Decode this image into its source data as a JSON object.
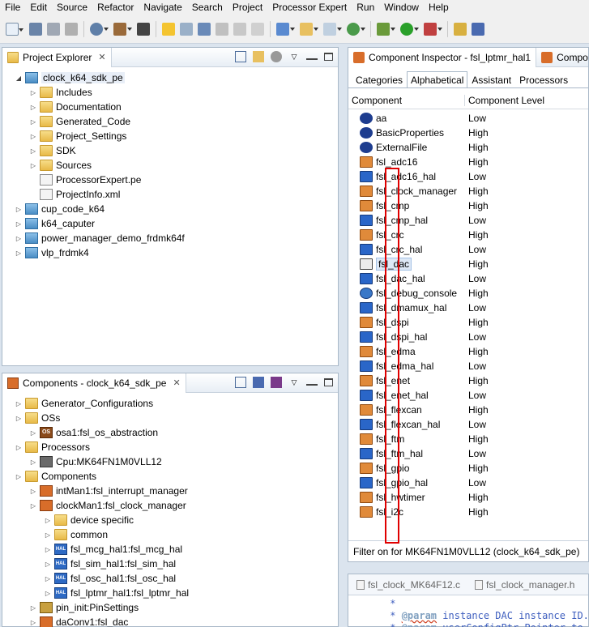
{
  "menu": [
    "File",
    "Edit",
    "Source",
    "Refactor",
    "Navigate",
    "Search",
    "Project",
    "Processor Expert",
    "Run",
    "Window",
    "Help"
  ],
  "project_explorer": {
    "title": "Project Explorer",
    "tree": [
      {
        "label": "clock_k64_sdk_pe",
        "level": 0,
        "type": "proj",
        "expanded": true
      },
      {
        "label": "Includes",
        "level": 1,
        "type": "folder"
      },
      {
        "label": "Documentation",
        "level": 1,
        "type": "folder"
      },
      {
        "label": "Generated_Code",
        "level": 1,
        "type": "folder"
      },
      {
        "label": "Project_Settings",
        "level": 1,
        "type": "folder"
      },
      {
        "label": "SDK",
        "level": 1,
        "type": "folder"
      },
      {
        "label": "Sources",
        "level": 1,
        "type": "folder"
      },
      {
        "label": "ProcessorExpert.pe",
        "level": 1,
        "type": "file"
      },
      {
        "label": "ProjectInfo.xml",
        "level": 1,
        "type": "file"
      },
      {
        "label": "cup_code_k64",
        "level": 0,
        "type": "proj"
      },
      {
        "label": "k64_caputer",
        "level": 0,
        "type": "proj"
      },
      {
        "label": "power_manager_demo_frdmk64f",
        "level": 0,
        "type": "proj"
      },
      {
        "label": "vlp_frdmk4",
        "level": 0,
        "type": "proj"
      }
    ]
  },
  "components_view": {
    "title": "Components - clock_k64_sdk_pe",
    "tree": [
      {
        "label": "Generator_Configurations",
        "level": 0,
        "type": "folder"
      },
      {
        "label": "OSs",
        "level": 0,
        "type": "folder"
      },
      {
        "label": "osa1:fsl_os_abstraction",
        "level": 1,
        "type": "os"
      },
      {
        "label": "Processors",
        "level": 0,
        "type": "folder"
      },
      {
        "label": "Cpu:MK64FN1M0VLL12",
        "level": 1,
        "type": "cpu"
      },
      {
        "label": "Components",
        "level": 0,
        "type": "folder"
      },
      {
        "label": "intMan1:fsl_interrupt_manager",
        "level": 1,
        "type": "comp"
      },
      {
        "label": "clockMan1:fsl_clock_manager",
        "level": 1,
        "type": "comp"
      },
      {
        "label": "device specific",
        "level": 2,
        "type": "folder"
      },
      {
        "label": "common",
        "level": 2,
        "type": "folder"
      },
      {
        "label": "fsl_mcg_hal1:fsl_mcg_hal",
        "level": 2,
        "type": "hal"
      },
      {
        "label": "fsl_sim_hal1:fsl_sim_hal",
        "level": 2,
        "type": "hal"
      },
      {
        "label": "fsl_osc_hal1:fsl_osc_hal",
        "level": 2,
        "type": "hal"
      },
      {
        "label": "fsl_lptmr_hal1:fsl_lptmr_hal",
        "level": 2,
        "type": "hal"
      },
      {
        "label": "pin_init:PinSettings",
        "level": 1,
        "type": "pin"
      },
      {
        "label": "daConv1:fsl_dac",
        "level": 1,
        "type": "comp"
      }
    ]
  },
  "inspector": {
    "title": "Component Inspector - fsl_lptmr_hal1",
    "second_tab": "Compo",
    "tabs": [
      "Categories",
      "Alphabetical",
      "Assistant",
      "Processors"
    ],
    "active_tab": "Alphabetical",
    "col_component": "Component",
    "col_level": "Component Level",
    "rows": [
      {
        "name": "aa",
        "level": "Low",
        "icon": "user"
      },
      {
        "name": "BasicProperties",
        "level": "High",
        "icon": "user"
      },
      {
        "name": "ExternalFile",
        "level": "High",
        "icon": "user"
      },
      {
        "name": "fsl_adc16",
        "level": "High",
        "icon": "comp"
      },
      {
        "name": "fsl_adc16_hal",
        "level": "Low",
        "icon": "hal"
      },
      {
        "name": "fsl_clock_manager",
        "level": "High",
        "icon": "comp"
      },
      {
        "name": "fsl_cmp",
        "level": "High",
        "icon": "comp"
      },
      {
        "name": "fsl_cmp_hal",
        "level": "Low",
        "icon": "hal"
      },
      {
        "name": "fsl_crc",
        "level": "High",
        "icon": "comp"
      },
      {
        "name": "fsl_crc_hal",
        "level": "Low",
        "icon": "hal"
      },
      {
        "name": "fsl_dac",
        "level": "High",
        "icon": "gray",
        "selected": true
      },
      {
        "name": "fsl_dac_hal",
        "level": "Low",
        "icon": "hal"
      },
      {
        "name": "fsl_debug_console",
        "level": "High",
        "icon": "dbg"
      },
      {
        "name": "fsl_dmamux_hal",
        "level": "Low",
        "icon": "hal"
      },
      {
        "name": "fsl_dspi",
        "level": "High",
        "icon": "comp"
      },
      {
        "name": "fsl_dspi_hal",
        "level": "Low",
        "icon": "hal"
      },
      {
        "name": "fsl_edma",
        "level": "High",
        "icon": "comp"
      },
      {
        "name": "fsl_edma_hal",
        "level": "Low",
        "icon": "hal"
      },
      {
        "name": "fsl_enet",
        "level": "High",
        "icon": "comp"
      },
      {
        "name": "fsl_enet_hal",
        "level": "Low",
        "icon": "hal"
      },
      {
        "name": "fsl_flexcan",
        "level": "High",
        "icon": "comp"
      },
      {
        "name": "fsl_flexcan_hal",
        "level": "Low",
        "icon": "hal"
      },
      {
        "name": "fsl_ftm",
        "level": "High",
        "icon": "comp"
      },
      {
        "name": "fsl_ftm_hal",
        "level": "Low",
        "icon": "hal"
      },
      {
        "name": "fsl_gpio",
        "level": "High",
        "icon": "comp"
      },
      {
        "name": "fsl_gpio_hal",
        "level": "Low",
        "icon": "hal"
      },
      {
        "name": "fsl_hwtimer",
        "level": "High",
        "icon": "comp"
      },
      {
        "name": "fsl_i2c",
        "level": "High",
        "icon": "comp"
      }
    ],
    "filter": "Filter on for MK64FN1M0VLL12 (clock_k64_sdk_pe)"
  },
  "editor": {
    "tabs": [
      "fsl_clock_MK64F12.c",
      "fsl_clock_manager.h"
    ],
    "lines": [
      {
        "prefix": " *",
        "tag": "",
        "rest": ""
      },
      {
        "prefix": " * ",
        "tag": "@param",
        "rest": " instance DAC instance ID."
      },
      {
        "prefix": " * ",
        "tag": "@param",
        "rest": " userConfigPtr Pointer to th"
      }
    ]
  }
}
